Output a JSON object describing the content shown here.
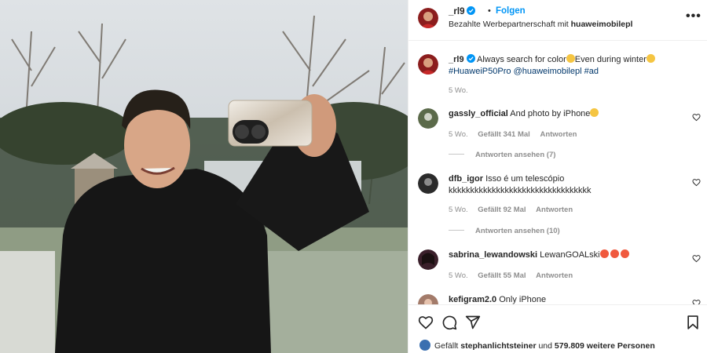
{
  "post": {
    "author": "_rl9",
    "follow_label": "Folgen",
    "separator": "•",
    "sponsored_prefix": "Bezahlte Werbepartnerschaft mit ",
    "sponsored_partner": "huaweimobilepl",
    "more_label": "•••"
  },
  "caption": {
    "username": "_rl9",
    "text_a": "Always search for color",
    "text_b": "Even during winter",
    "tag1": "#HuaweiP50Pro",
    "tag2": "@huaweimobilepl",
    "tag3": "#ad",
    "time": "5 Wo."
  },
  "comments": [
    {
      "username": "gassly_official",
      "text": "And photo by iPhone",
      "time": "5 Wo.",
      "likes": "Gefällt 341 Mal",
      "reply": "Antworten",
      "view_replies": "Antworten ansehen (7)"
    },
    {
      "username": "dfb_igor",
      "text": "Isso é um telescópio kkkkkkkkkkkkkkkkkkkkkkkkkkkkkkkkk",
      "time": "5 Wo.",
      "likes": "Gefällt 92 Mal",
      "reply": "Antworten",
      "view_replies": "Antworten ansehen (10)"
    },
    {
      "username": "sabrina_lewandowski",
      "text": "LewanGOALski",
      "time": "5 Wo.",
      "likes": "Gefällt 55 Mal",
      "reply": "Antworten"
    },
    {
      "username": "kefigram2.0",
      "text": "Only iPhone"
    }
  ],
  "likes_line": {
    "prefix": "Gefällt ",
    "user": "stephanlichtsteiner",
    "middle": " und ",
    "count": "579.809 weitere Personen"
  },
  "icons": {
    "verified": "verified-badge-icon",
    "heart": "heart-icon",
    "comment": "comment-icon",
    "share": "share-icon",
    "save": "bookmark-icon",
    "more": "more-icon"
  },
  "colors": {
    "link": "#0095f6",
    "tag": "#00376b",
    "muted": "#8e8e8e",
    "text": "#262626"
  }
}
